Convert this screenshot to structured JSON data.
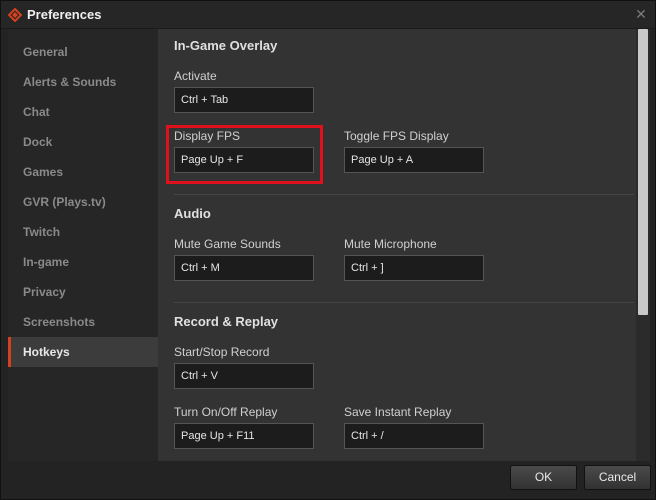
{
  "window": {
    "title": "Preferences",
    "close_glyph": "✕"
  },
  "sidebar": {
    "items": [
      {
        "label": "General"
      },
      {
        "label": "Alerts & Sounds"
      },
      {
        "label": "Chat"
      },
      {
        "label": "Dock"
      },
      {
        "label": "Games"
      },
      {
        "label": "GVR (Plays.tv)"
      },
      {
        "label": "Twitch"
      },
      {
        "label": "In-game"
      },
      {
        "label": "Privacy"
      },
      {
        "label": "Screenshots"
      },
      {
        "label": "Hotkeys",
        "active": true
      }
    ]
  },
  "sections": {
    "overlay": {
      "title": "In-Game Overlay",
      "activate_label": "Activate",
      "activate_value": "Ctrl + Tab",
      "display_fps_label": "Display FPS",
      "display_fps_value": "Page Up + F",
      "toggle_fps_label": "Toggle FPS Display",
      "toggle_fps_value": "Page Up + A"
    },
    "audio": {
      "title": "Audio",
      "mute_game_label": "Mute Game Sounds",
      "mute_game_value": "Ctrl + M",
      "mute_mic_label": "Mute Microphone",
      "mute_mic_value": "Ctrl + ]"
    },
    "record": {
      "title": "Record & Replay",
      "startstop_label": "Start/Stop Record",
      "startstop_value": "Ctrl + V",
      "replay_toggle_label": "Turn On/Off Replay",
      "replay_toggle_value": "Page Up + F11",
      "save_replay_label": "Save Instant Replay",
      "save_replay_value": "Ctrl + /"
    }
  },
  "footer": {
    "ok_label": "OK",
    "cancel_label": "Cancel"
  },
  "colors": {
    "accent": "#d4411f",
    "highlight": "#e0101c",
    "content_bg": "#333333",
    "sidebar_bg": "#262626"
  },
  "icons": {
    "app": "raptr-logo-icon",
    "close": "close-icon"
  }
}
